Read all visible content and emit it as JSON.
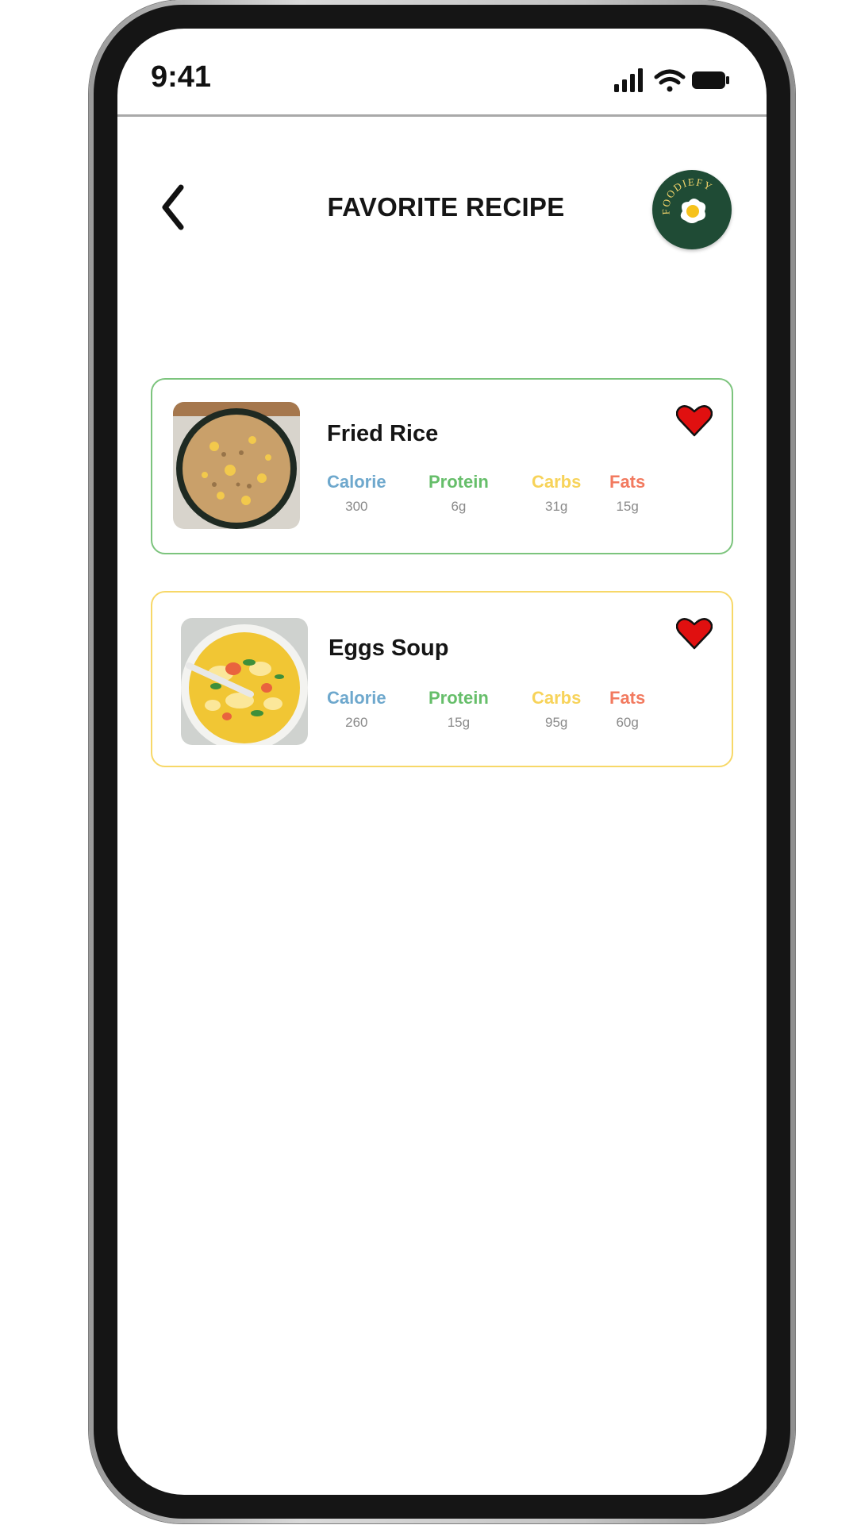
{
  "status_bar": {
    "time": "9:41",
    "icons": [
      "cellular-signal-icon",
      "wifi-icon",
      "battery-icon"
    ]
  },
  "header": {
    "back_icon": "chevron-left-icon",
    "title": "FAVORITE RECIPE",
    "logo_text": "FOODIEFY"
  },
  "colors": {
    "calorie": "#6ea8cd",
    "protein": "#66be6a",
    "carbs": "#f7d35a",
    "fats": "#f27a5f",
    "heart": "#e01010",
    "logo_bg": "#1f4b35",
    "card_green_border": "#7cc47d",
    "card_yellow_border": "#f7d868"
  },
  "recipes": [
    {
      "name": "Fried Rice",
      "image": "fried-rice-photo",
      "favorite": true,
      "nutrients": [
        {
          "label": "Calorie",
          "value": "300"
        },
        {
          "label": "Protein",
          "value": "6g"
        },
        {
          "label": "Carbs",
          "value": "31g"
        },
        {
          "label": "Fats",
          "value": "15g"
        }
      ]
    },
    {
      "name": "Eggs Soup",
      "image": "eggs-soup-photo",
      "favorite": true,
      "nutrients": [
        {
          "label": "Calorie",
          "value": "260"
        },
        {
          "label": "Protein",
          "value": "15g"
        },
        {
          "label": "Carbs",
          "value": "95g"
        },
        {
          "label": "Fats",
          "value": "60g"
        }
      ]
    }
  ]
}
